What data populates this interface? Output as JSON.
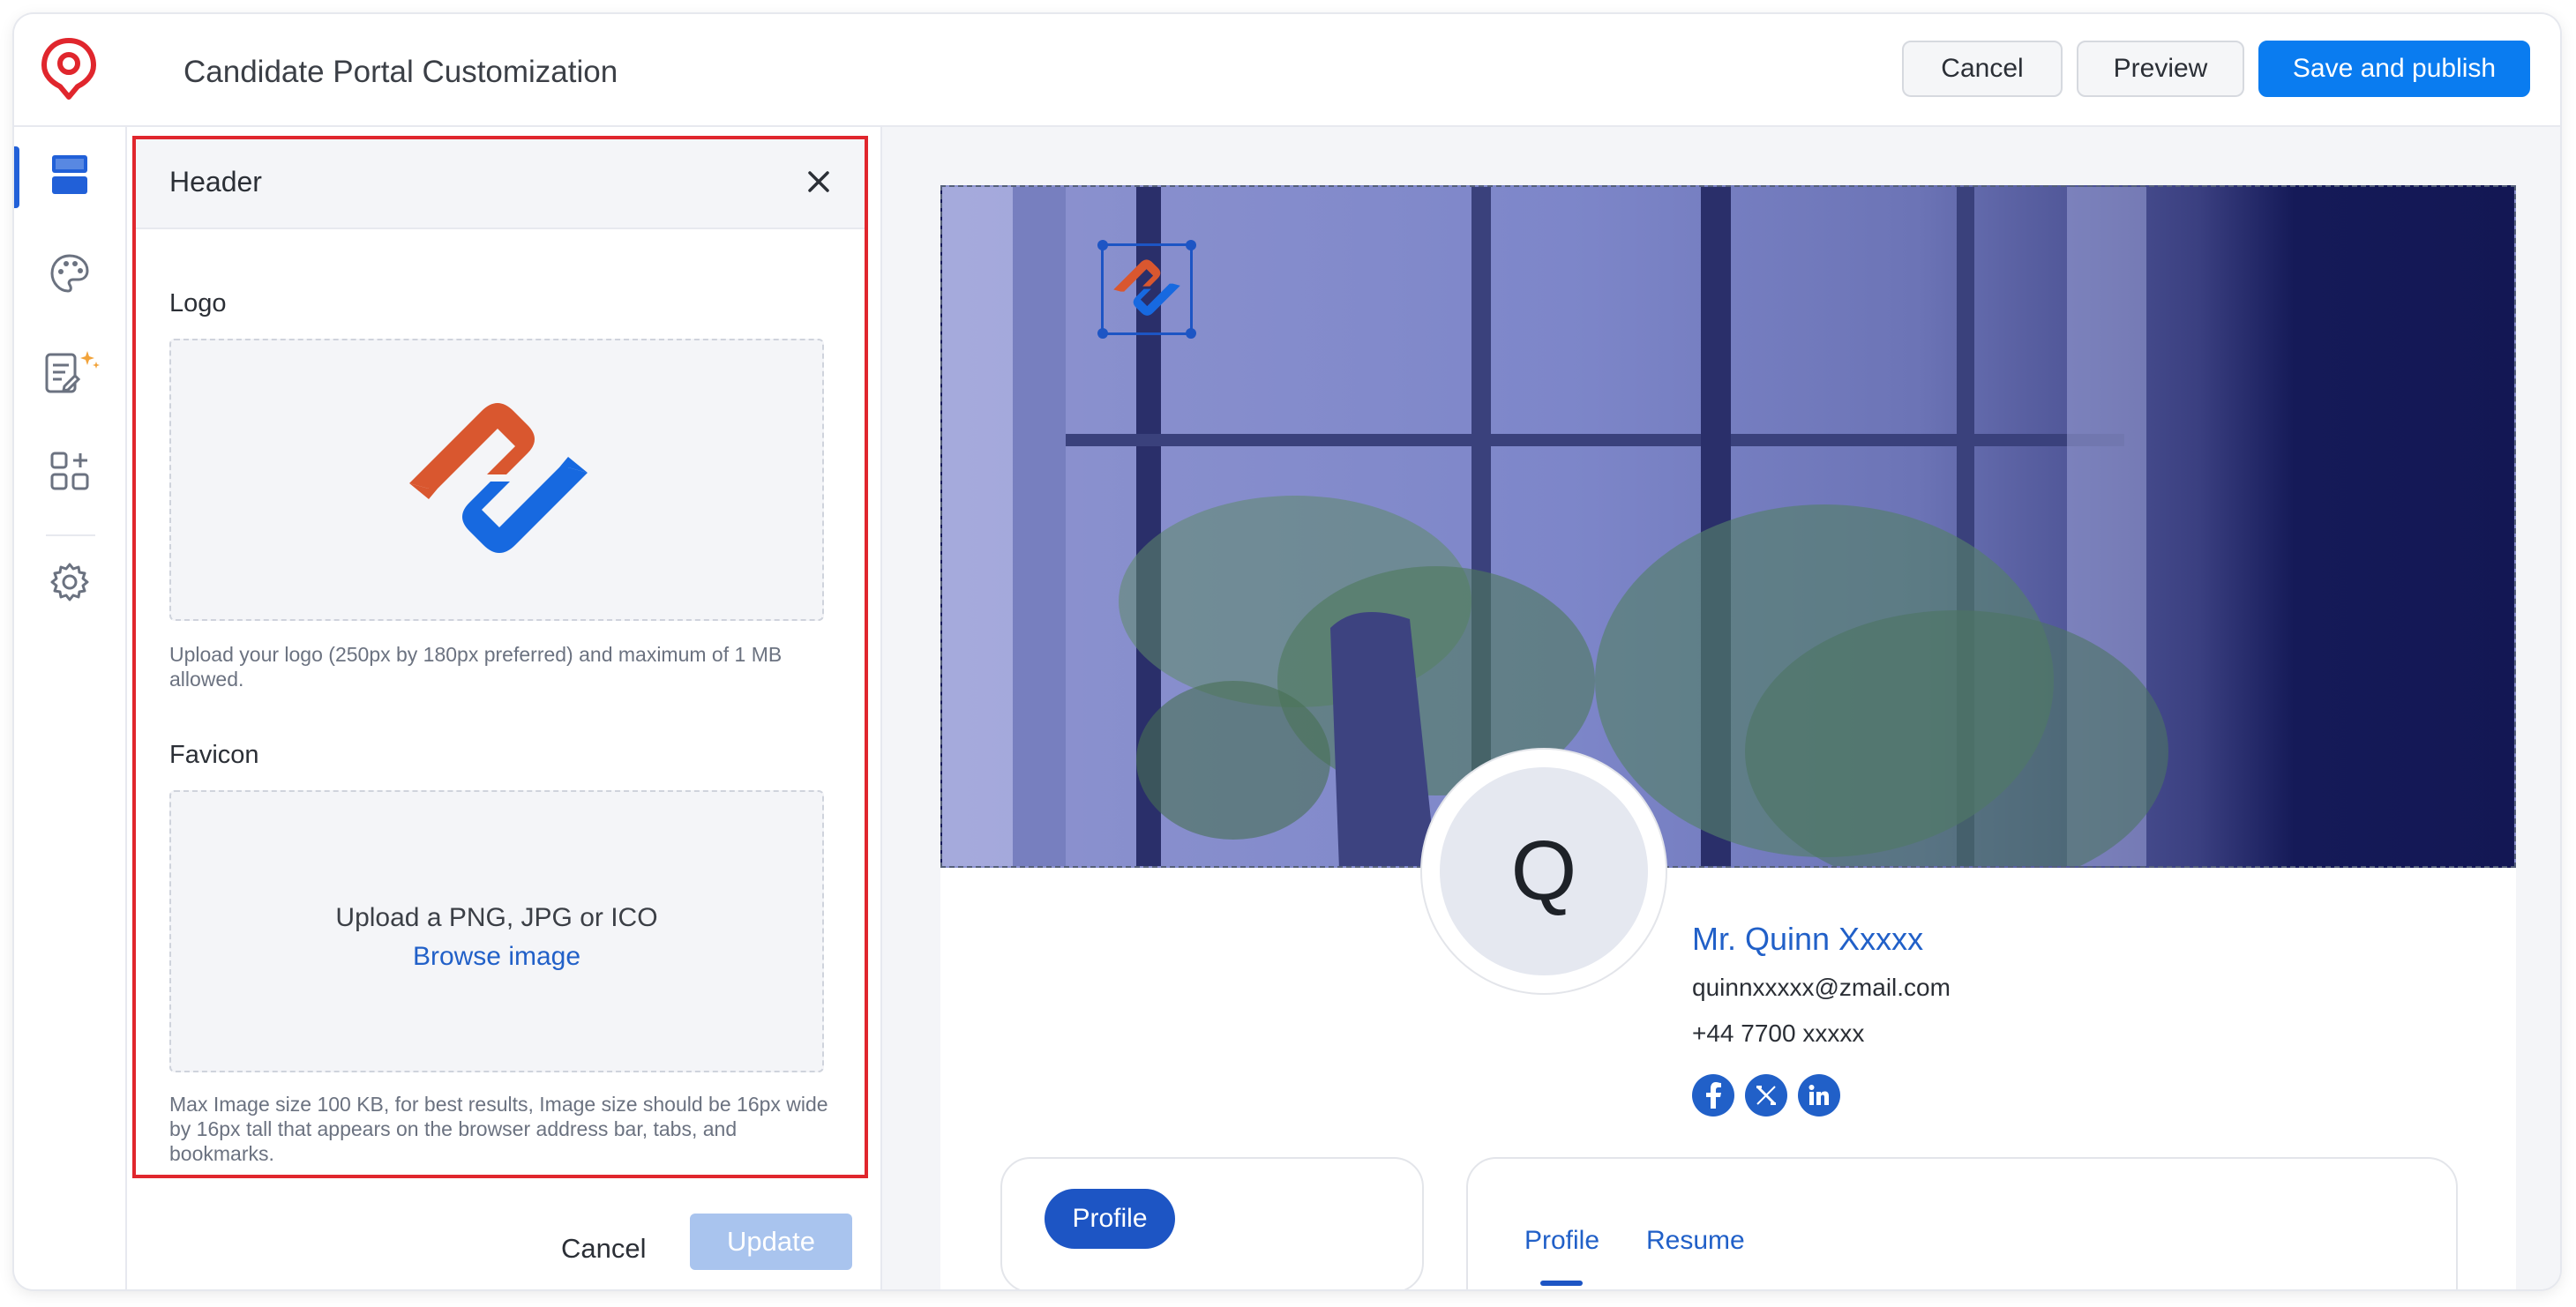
{
  "app": {
    "title": "Candidate Portal Customization",
    "brand_icon": "recruit-logo-icon",
    "accent_color": "#0a7cf0",
    "highlight_color": "#e0262d"
  },
  "toolbar": {
    "cancel_label": "Cancel",
    "preview_label": "Preview",
    "publish_label": "Save and publish"
  },
  "rail": {
    "items": [
      {
        "icon": "layout-sections-icon",
        "active": true
      },
      {
        "icon": "palette-icon",
        "active": false
      },
      {
        "icon": "ai-form-icon",
        "active": false
      },
      {
        "icon": "add-widget-icon",
        "active": false
      },
      {
        "icon": "gear-icon",
        "active": false
      }
    ]
  },
  "panel": {
    "title": "Header",
    "logo_label": "Logo",
    "logo_hint": "Upload your logo (250px by 180px preferred) and maximum of 1 MB allowed.",
    "favicon_label": "Favicon",
    "favicon_upload_text": "Upload a PNG, JPG or ICO",
    "favicon_browse": "Browse image",
    "favicon_hint": "Max Image size 100 KB, for best results, Image size should be 16px wide by 16px tall that appears on the browser address bar, tabs, and bookmarks.",
    "cancel_label": "Cancel",
    "update_label": "Update"
  },
  "preview": {
    "avatar_initial": "Q",
    "name": "Mr. Quinn Xxxxx",
    "email": "quinnxxxxx@zmail.com",
    "phone": "+44 7700 xxxxx",
    "social": [
      "facebook-icon",
      "x-icon",
      "linkedin-icon"
    ],
    "left_pill": "Profile",
    "tabs": [
      "Profile",
      "Resume"
    ]
  }
}
